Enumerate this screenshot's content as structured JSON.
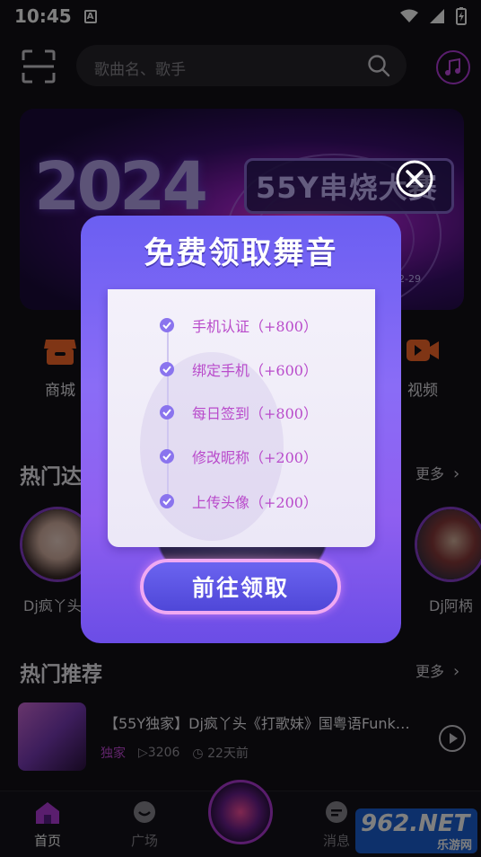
{
  "status_bar": {
    "time": "10:45",
    "app_badge": "A"
  },
  "search": {
    "placeholder": "歌曲名、歌手"
  },
  "banner": {
    "year_art": "2024",
    "sign_text": "55Y串烧大赛",
    "date_fragment": "12-29"
  },
  "categories": [
    {
      "label": "商城",
      "icon": "shop-icon",
      "color": "#ff6a2a"
    },
    {
      "label": "视频",
      "icon": "video-icon",
      "color": "#ff6a2a"
    }
  ],
  "hot_djs": {
    "title": "热门达",
    "more": "更多",
    "names": [
      "Dj疯丫头",
      "Dj阿柄"
    ]
  },
  "recommend": {
    "title": "热门推荐",
    "more": "更多",
    "song": {
      "title": "【55Y独家】Dj疯丫头《打歌妹》国粤语Funk…",
      "tag": "独家",
      "plays": "3206",
      "time": "22天前"
    }
  },
  "tabs": [
    {
      "label": "首页",
      "icon": "home-icon",
      "active": true
    },
    {
      "label": "广场",
      "icon": "chat-icon",
      "active": false
    },
    {
      "label": "消息",
      "icon": "message-icon",
      "active": false
    }
  ],
  "watermark": {
    "big": "962.NET",
    "small": "乐游网"
  },
  "popup": {
    "title": "免费领取舞音",
    "tasks": [
      "手机认证（+800）",
      "绑定手机（+600）",
      "每日签到（+800）",
      "修改昵称（+200）",
      "上传头像（+200）"
    ],
    "cta": "前往领取"
  },
  "colors": {
    "accent": "#b53cdd",
    "popup": "#7a66f2",
    "task_text": "#b94bcb",
    "brand_orange": "#ff6a2a"
  }
}
